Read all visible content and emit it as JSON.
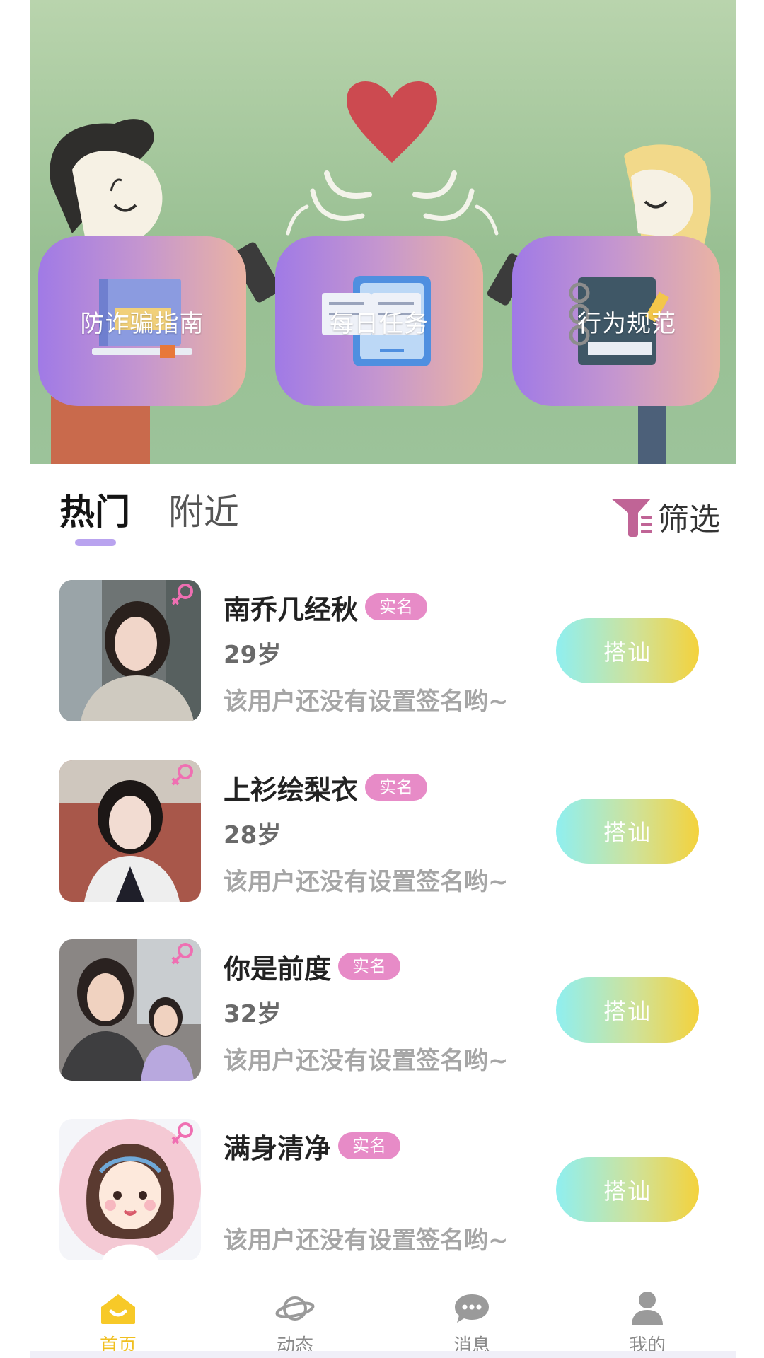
{
  "banner": {
    "features": [
      {
        "label": "防诈骗指南",
        "icon": "book-icon"
      },
      {
        "label": "每日任务",
        "icon": "task-phone-icon"
      },
      {
        "label": "行为规范",
        "icon": "notebook-icon"
      }
    ]
  },
  "tabs": {
    "hot": "热门",
    "nearby": "附近",
    "filter_label": "筛选"
  },
  "users": [
    {
      "name": "南乔几经秋",
      "badge": "实名",
      "age": "29岁",
      "signature": "该用户还没有设置签名哟~",
      "action": "搭讪",
      "gender_icon": "female-icon"
    },
    {
      "name": "上衫绘梨衣",
      "badge": "实名",
      "age": "28岁",
      "signature": "该用户还没有设置签名哟~",
      "action": "搭讪",
      "gender_icon": "female-icon"
    },
    {
      "name": "你是前度",
      "badge": "实名",
      "age": "32岁",
      "signature": "该用户还没有设置签名哟~",
      "action": "搭讪",
      "gender_icon": "female-icon"
    },
    {
      "name": "满身清净",
      "badge": "实名",
      "age": "",
      "signature": "该用户还没有设置签名哟~",
      "action": "搭讪",
      "gender_icon": "female-icon"
    }
  ],
  "nav": {
    "home": "首页",
    "moments": "动态",
    "messages": "消息",
    "mine": "我的"
  },
  "colors": {
    "accent_yellow": "#f0bf1f",
    "badge_pink": "#e78bc7",
    "tab_underline": "#b9a3ef"
  }
}
